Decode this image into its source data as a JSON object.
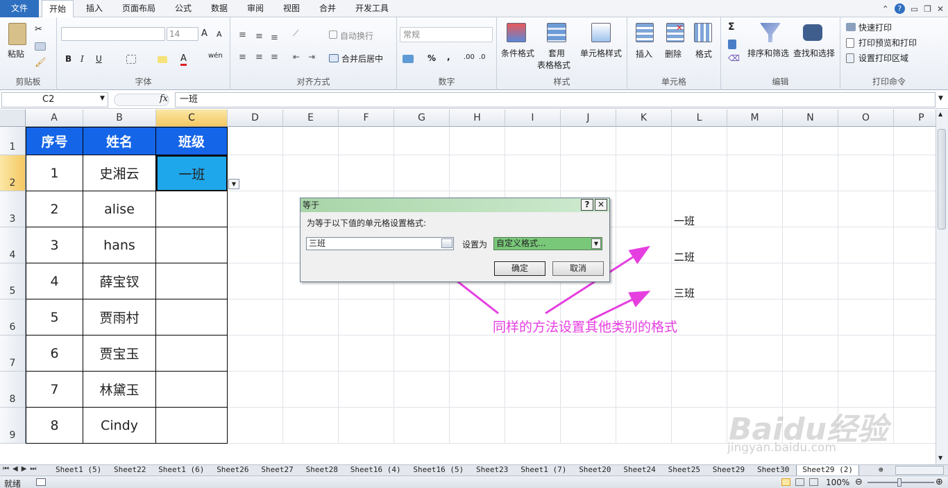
{
  "ribbon_tabs": [
    "文件",
    "开始",
    "插入",
    "页面布局",
    "公式",
    "数据",
    "审阅",
    "视图",
    "合并",
    "开发工具"
  ],
  "groups": {
    "clipboard": {
      "label": "剪贴板",
      "paste": "粘贴"
    },
    "font": {
      "label": "字体",
      "size": "14",
      "bold": "B",
      "italic": "I",
      "underline": "U",
      "grow": "A",
      "shrink": "A",
      "wen": "wén"
    },
    "align": {
      "label": "对齐方式",
      "wrap": "自动换行",
      "merge": "合并后居中"
    },
    "number": {
      "label": "数字",
      "format": "常规",
      "pct": "%",
      "comma": ","
    },
    "styles": {
      "label": "样式",
      "cond": "条件格式",
      "table1": "套用",
      "table2": "表格格式",
      "cell": "单元格样式"
    },
    "cells": {
      "label": "单元格",
      "insert": "插入",
      "delete": "删除",
      "format": "格式"
    },
    "edit": {
      "label": "编辑",
      "sum": "Σ",
      "sort": "排序和筛选",
      "find": "查找和选择"
    },
    "print": {
      "label": "打印命令",
      "quick": "快速打印",
      "preview": "打印预览和打印",
      "area": "设置打印区域"
    }
  },
  "formula_bar": {
    "name": "C2",
    "fx": "fx",
    "value": "一班"
  },
  "columns": [
    "A",
    "B",
    "C",
    "D",
    "E",
    "F",
    "G",
    "H",
    "I",
    "J",
    "K",
    "L",
    "M",
    "N",
    "O",
    "P"
  ],
  "rows": [
    "1",
    "2",
    "3",
    "4",
    "5",
    "6",
    "7",
    "8",
    "9"
  ],
  "table": {
    "headers": [
      "序号",
      "姓名",
      "班级"
    ],
    "rows": [
      [
        "1",
        "史湘云",
        "一班"
      ],
      [
        "2",
        "alise",
        ""
      ],
      [
        "3",
        "hans",
        ""
      ],
      [
        "4",
        "薛宝钗",
        ""
      ],
      [
        "5",
        "贾雨村",
        ""
      ],
      [
        "6",
        "贾宝玉",
        ""
      ],
      [
        "7",
        "林黛玉",
        ""
      ],
      [
        "8",
        "Cindy",
        ""
      ]
    ]
  },
  "side_labels": [
    "一班",
    "二班",
    "三班"
  ],
  "dialog": {
    "title": "等于",
    "help": "?",
    "close": "✕",
    "prompt": "为等于以下值的单元格设置格式:",
    "value": "三班",
    "set_as": "设置为",
    "format": "自定义格式...",
    "ok": "确定",
    "cancel": "取消"
  },
  "annotation": "同样的方法设置其他类别的格式",
  "annotation_color": "#e53fe0",
  "sheet_tabs": [
    "Sheet1 (5)",
    "Sheet22",
    "Sheet1 (6)",
    "Sheet26",
    "Sheet27",
    "Sheet28",
    "Sheet16 (4)",
    "Sheet16 (5)",
    "Sheet23",
    "Sheet1 (7)",
    "Sheet20",
    "Sheet24",
    "Sheet25",
    "Sheet29",
    "Sheet30",
    "Sheet29 (2)"
  ],
  "status": {
    "ready": "就绪",
    "zoom": "100%"
  },
  "watermark": {
    "brand": "Baidu经验",
    "url": "jingyan.baidu.com"
  }
}
